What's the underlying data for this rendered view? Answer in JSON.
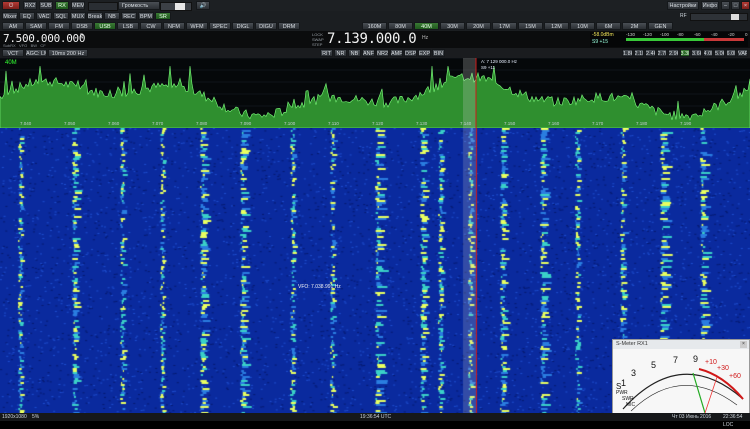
{
  "row1": {
    "power_label": "⏻",
    "rx2_label": "RX2",
    "sub_label": "SUB",
    "rx_label": "RX",
    "mem_label": "MEM",
    "volume_label": "Громкость",
    "settings_label": "Настройки",
    "info_label": "Инфо"
  },
  "row2": {
    "buttons": [
      "Mixer",
      "EQ",
      "VAC",
      "SQL",
      "MUX",
      "Breakin",
      "NB",
      "REC",
      "BPM",
      "SR"
    ],
    "rf_label": "RF"
  },
  "row3": {
    "modes": [
      "AM",
      "SAM",
      "FM",
      "DSB",
      "USB",
      "LSB",
      "CW",
      "NFM",
      "WFM",
      "SPEC",
      "DIGL",
      "DIGU",
      "DRM"
    ],
    "bands": [
      "160M",
      "80M",
      "40M",
      "30M",
      "20M",
      "17M",
      "15M",
      "12M",
      "10M",
      "6M",
      "2M",
      "GEN"
    ]
  },
  "freq_main": {
    "value": "7.500.000.000",
    "small": "0",
    "labels": [
      "SubRX",
      "VFO",
      "BW",
      "CF"
    ]
  },
  "freq_center": {
    "left_labels": [
      "LOCK",
      "SWAP",
      "STEP"
    ],
    "value": "7.139.000.0",
    "unit": "Hz"
  },
  "meter": {
    "value": "-58.0dBm",
    "sval": "S9 +15",
    "scale": [
      "-130",
      "-120",
      "-100",
      "-80",
      "-60",
      "-40",
      "-20",
      "0"
    ]
  },
  "row5": {
    "left": [
      "VCT",
      "AGC: LMM",
      "10ms  200 Hz"
    ],
    "mid": [
      "RIT",
      "NR",
      "NB",
      "ANF",
      "NR2",
      "AMP",
      "DSP",
      "EXP",
      "BIN"
    ],
    "right": [
      "1.8K",
      "2.1K",
      "2.4K",
      "2.7K",
      "2.9K",
      "3.3K",
      "3.6K",
      "4.0K",
      "5.0K",
      "6.0K",
      "VAR"
    ]
  },
  "spectrum": {
    "band_label": "40M",
    "cursor_readout": "A: 7 129 000.0 Hz",
    "cursor_readout2": "S9 +11",
    "freq_ticks": [
      "7.040",
      "7.050",
      "7.060",
      "7.070",
      "7.080",
      "7.090",
      "7.100",
      "7.110",
      "7.120",
      "7.130",
      "7.140",
      "7.150",
      "7.160",
      "7.170",
      "7.180",
      "7.190"
    ]
  },
  "waterfall": {
    "vfo_readout": "VFO: 7.038.991 Hz"
  },
  "status": {
    "left": "1920x1080",
    "cpu": "5%",
    "center": "19:36:54 UTC",
    "date": "Чт 03 Июнь 2016",
    "local": "22:36:54 LOC"
  },
  "smeter": {
    "title": "S-Meter RX1",
    "s_scale": [
      "1",
      "3",
      "5",
      "7",
      "9",
      "+10",
      "+30",
      "+60"
    ],
    "labels": [
      "S",
      "PWR",
      "SWR",
      "MIC"
    ]
  },
  "colors": {
    "accent_green": "#3fb33f",
    "waterfall_blue": "#0a2a9e",
    "waterfall_yellow": "#e8ff60",
    "cursor_red": "#d01818"
  }
}
